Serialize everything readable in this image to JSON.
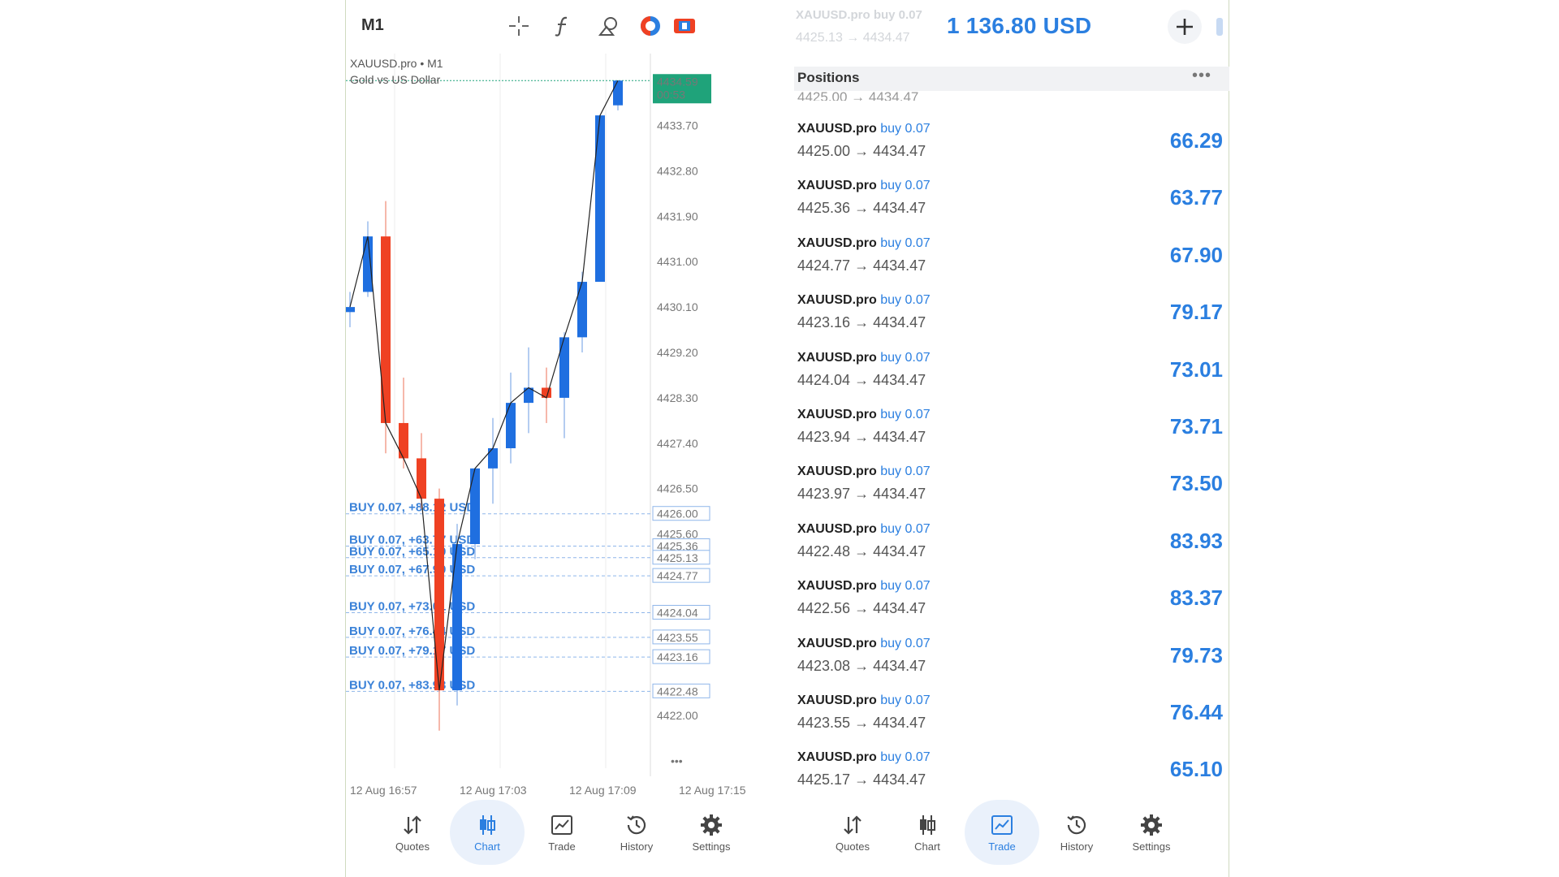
{
  "left": {
    "timeframe": "M1",
    "symbol_line": "XAUUSD.pro • M1",
    "description": "Gold vs US Dollar",
    "toolbar_icons": [
      "crosshair-icon",
      "function-icon",
      "object-icon",
      "theme-icon",
      "chart-type-icon"
    ],
    "current_price": "4434.59",
    "countdown": "00:53",
    "more": "•••",
    "accent_green": "#1fa37a",
    "bull_color": "#1f6fe0",
    "bear_color": "#ef4123"
  },
  "chart_data": {
    "type": "candlestick",
    "price_ticks": [
      "4433.70",
      "4432.80",
      "4431.90",
      "4431.00",
      "4430.10",
      "4429.20",
      "4428.30",
      "4427.40",
      "4426.50",
      "4425.60",
      "4422.00"
    ],
    "time_ticks": [
      "12 Aug 16:57",
      "12 Aug 17:03",
      "12 Aug 17:09",
      "12 Aug 17:15"
    ],
    "ylim": [
      4421.6,
      4434.9
    ],
    "candles": [
      {
        "o": 4430.0,
        "h": 4430.4,
        "l": 4429.7,
        "c": 4430.1
      },
      {
        "o": 4430.4,
        "h": 4431.8,
        "l": 4430.3,
        "c": 4431.5
      },
      {
        "o": 4431.5,
        "h": 4432.2,
        "l": 4427.2,
        "c": 4427.8
      },
      {
        "o": 4427.8,
        "h": 4428.7,
        "l": 4426.9,
        "c": 4427.1
      },
      {
        "o": 4427.1,
        "h": 4427.6,
        "l": 4426.1,
        "c": 4426.3
      },
      {
        "o": 4426.3,
        "h": 4426.5,
        "l": 4421.7,
        "c": 4422.5
      },
      {
        "o": 4422.5,
        "h": 4425.8,
        "l": 4422.2,
        "c": 4425.4
      },
      {
        "o": 4425.4,
        "h": 4426.9,
        "l": 4425.1,
        "c": 4426.9
      },
      {
        "o": 4426.9,
        "h": 4427.9,
        "l": 4426.2,
        "c": 4427.3
      },
      {
        "o": 4427.3,
        "h": 4428.8,
        "l": 4427.0,
        "c": 4428.2
      },
      {
        "o": 4428.2,
        "h": 4429.3,
        "l": 4427.6,
        "c": 4428.5
      },
      {
        "o": 4428.5,
        "h": 4428.9,
        "l": 4427.8,
        "c": 4428.3
      },
      {
        "o": 4428.3,
        "h": 4429.6,
        "l": 4427.5,
        "c": 4429.5
      },
      {
        "o": 4429.5,
        "h": 4430.8,
        "l": 4429.2,
        "c": 4430.6
      },
      {
        "o": 4430.6,
        "h": 4433.9,
        "l": 4430.6,
        "c": 4433.9
      },
      {
        "o": 4434.1,
        "h": 4434.6,
        "l": 4434.0,
        "c": 4434.59
      }
    ],
    "order_levels": [
      {
        "price": "4426.00",
        "label": "BUY 0.07, +88.12 USD"
      },
      {
        "price": "4425.36",
        "label": "BUY 0.07, +63.77 USD"
      },
      {
        "price": "4425.13",
        "label": "BUY 0.07, +65.10 USD"
      },
      {
        "price": "4424.77",
        "label": "BUY 0.07, +67.90 USD"
      },
      {
        "price": "4424.04",
        "label": "BUY 0.07, +73.01 USD"
      },
      {
        "price": "4423.55",
        "label": "BUY 0.07, +76.44 USD"
      },
      {
        "price": "4423.16",
        "label": "BUY 0.07, +79.17 USD"
      },
      {
        "price": "4422.48",
        "label": "BUY 0.07, +83.93 USD"
      }
    ]
  },
  "right": {
    "ghost_symbol": "XAUUSD.pro buy 0.07",
    "ghost_prices": "4425.13 → 4434.47",
    "balance": "1 136.80 USD",
    "add_icon": "plus-icon",
    "positions_title": "Positions",
    "positions_more": "•••",
    "partial_row": "4425.00 → 4434.47",
    "positions": [
      {
        "symbol": "XAUUSD.pro",
        "side": "buy 0.07",
        "prices": "4425.00 → 4434.47",
        "profit": "66.29"
      },
      {
        "symbol": "XAUUSD.pro",
        "side": "buy 0.07",
        "prices": "4425.36 → 4434.47",
        "profit": "63.77"
      },
      {
        "symbol": "XAUUSD.pro",
        "side": "buy 0.07",
        "prices": "4424.77 → 4434.47",
        "profit": "67.90"
      },
      {
        "symbol": "XAUUSD.pro",
        "side": "buy 0.07",
        "prices": "4423.16 → 4434.47",
        "profit": "79.17"
      },
      {
        "symbol": "XAUUSD.pro",
        "side": "buy 0.07",
        "prices": "4424.04 → 4434.47",
        "profit": "73.01"
      },
      {
        "symbol": "XAUUSD.pro",
        "side": "buy 0.07",
        "prices": "4423.94 → 4434.47",
        "profit": "73.71"
      },
      {
        "symbol": "XAUUSD.pro",
        "side": "buy 0.07",
        "prices": "4423.97 → 4434.47",
        "profit": "73.50"
      },
      {
        "symbol": "XAUUSD.pro",
        "side": "buy 0.07",
        "prices": "4422.48 → 4434.47",
        "profit": "83.93"
      },
      {
        "symbol": "XAUUSD.pro",
        "side": "buy 0.07",
        "prices": "4422.56 → 4434.47",
        "profit": "83.37"
      },
      {
        "symbol": "XAUUSD.pro",
        "side": "buy 0.07",
        "prices": "4423.08 → 4434.47",
        "profit": "79.73"
      },
      {
        "symbol": "XAUUSD.pro",
        "side": "buy 0.07",
        "prices": "4423.55 → 4434.47",
        "profit": "76.44"
      },
      {
        "symbol": "XAUUSD.pro",
        "side": "buy 0.07",
        "prices": "4425.17 → 4434.47",
        "profit": "65.10"
      }
    ]
  },
  "nav_left": {
    "active": "Chart",
    "items": [
      {
        "label": "Quotes",
        "icon": "quotes-icon"
      },
      {
        "label": "Chart",
        "icon": "chart-icon"
      },
      {
        "label": "Trade",
        "icon": "trade-icon"
      },
      {
        "label": "History",
        "icon": "history-icon"
      },
      {
        "label": "Settings",
        "icon": "settings-icon"
      }
    ]
  },
  "nav_right": {
    "active": "Trade",
    "items": [
      {
        "label": "Quotes",
        "icon": "quotes-icon"
      },
      {
        "label": "Chart",
        "icon": "chart-icon"
      },
      {
        "label": "Trade",
        "icon": "trade-icon"
      },
      {
        "label": "History",
        "icon": "history-icon"
      },
      {
        "label": "Settings",
        "icon": "settings-icon"
      }
    ]
  }
}
